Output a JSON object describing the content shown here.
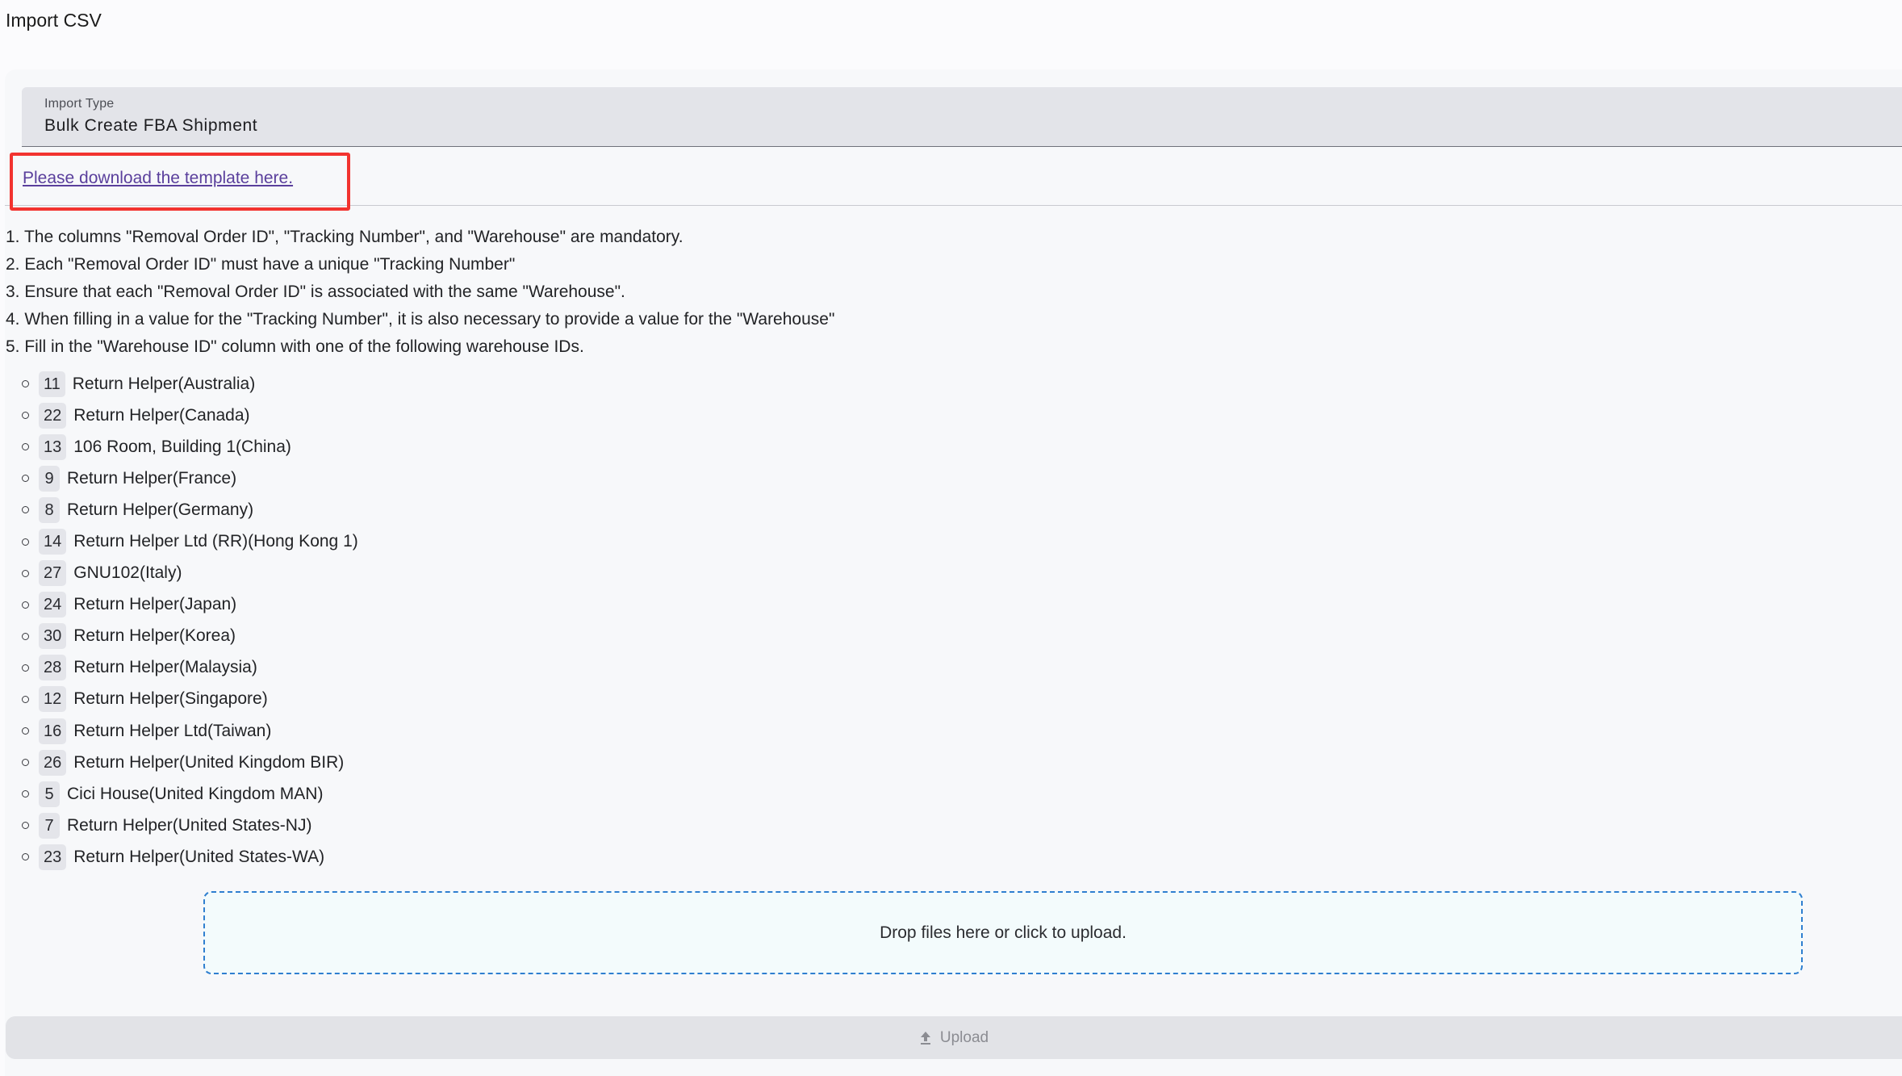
{
  "page": {
    "title": "Import CSV"
  },
  "import_type": {
    "label": "Import Type",
    "value": "Bulk Create FBA Shipment"
  },
  "template": {
    "link_text": "Please download the template here."
  },
  "rules": [
    "1. The columns \"Removal Order ID\", \"Tracking Number\", and \"Warehouse\" are mandatory.",
    "2. Each \"Removal Order ID\" must have a unique \"Tracking Number\"",
    "3. Ensure that each \"Removal Order ID\" is associated with the same \"Warehouse\".",
    "4. When filling in a value for the \"Tracking Number\", it is also necessary to provide a value for the \"Warehouse\"",
    "5. Fill in the \"Warehouse ID\" column with one of the following warehouse IDs."
  ],
  "warehouses": [
    {
      "id": "11",
      "name": "Return Helper(Australia)"
    },
    {
      "id": "22",
      "name": "Return Helper(Canada)"
    },
    {
      "id": "13",
      "name": "106 Room, Building 1(China)"
    },
    {
      "id": "9",
      "name": "Return Helper(France)"
    },
    {
      "id": "8",
      "name": "Return Helper(Germany)"
    },
    {
      "id": "14",
      "name": "Return Helper Ltd (RR)(Hong Kong 1)"
    },
    {
      "id": "27",
      "name": "GNU102(Italy)"
    },
    {
      "id": "24",
      "name": "Return Helper(Japan)"
    },
    {
      "id": "30",
      "name": "Return Helper(Korea)"
    },
    {
      "id": "28",
      "name": "Return Helper(Malaysia)"
    },
    {
      "id": "12",
      "name": "Return Helper(Singapore)"
    },
    {
      "id": "16",
      "name": "Return Helper Ltd(Taiwan)"
    },
    {
      "id": "26",
      "name": "Return Helper(United Kingdom BIR)"
    },
    {
      "id": "5",
      "name": "Cici House(United Kingdom MAN)"
    },
    {
      "id": "7",
      "name": "Return Helper(United States-NJ)"
    },
    {
      "id": "23",
      "name": "Return Helper(United States-WA)"
    }
  ],
  "dropzone": {
    "text": "Drop files here or click to upload."
  },
  "upload": {
    "label": "Upload",
    "icon": "upload-icon"
  },
  "colors": {
    "highlight_border": "#f2332f",
    "link": "#5a3f9c",
    "dropzone_border": "#2f7fd0"
  }
}
